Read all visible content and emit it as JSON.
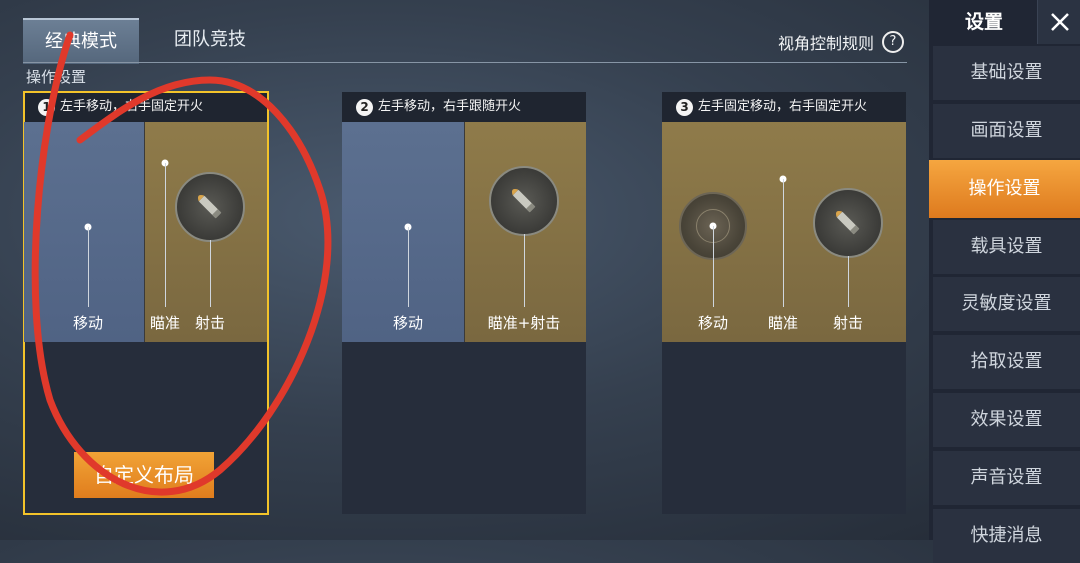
{
  "tabs": [
    {
      "label": "经典模式",
      "active": true
    },
    {
      "label": "团队竞技",
      "active": false
    }
  ],
  "rules_link": "视角控制规则",
  "help_icon": "question-icon",
  "section_title": "操作设置",
  "cards": [
    {
      "num": "1",
      "title": "左手移动，右手固定开火",
      "labels": [
        "移动",
        "瞄准",
        "射击"
      ],
      "selected": true
    },
    {
      "num": "2",
      "title": "左手移动，右手跟随开火",
      "labels": [
        "移动",
        "瞄准+射击"
      ],
      "selected": false
    },
    {
      "num": "3",
      "title": "左手固定移动，右手固定开火",
      "labels": [
        "移动",
        "瞄准",
        "射击"
      ],
      "selected": false
    }
  ],
  "custom_layout_button": "自定义布局",
  "sidebar": {
    "title": "设置",
    "items": [
      "基础设置",
      "画面设置",
      "操作设置",
      "载具设置",
      "灵敏度设置",
      "拾取设置",
      "效果设置",
      "声音设置",
      "快捷消息"
    ],
    "active_index": 2
  },
  "colors": {
    "accent": "#e8861f",
    "selected_border": "#f3c32a",
    "annotation_red": "#e0392b"
  }
}
